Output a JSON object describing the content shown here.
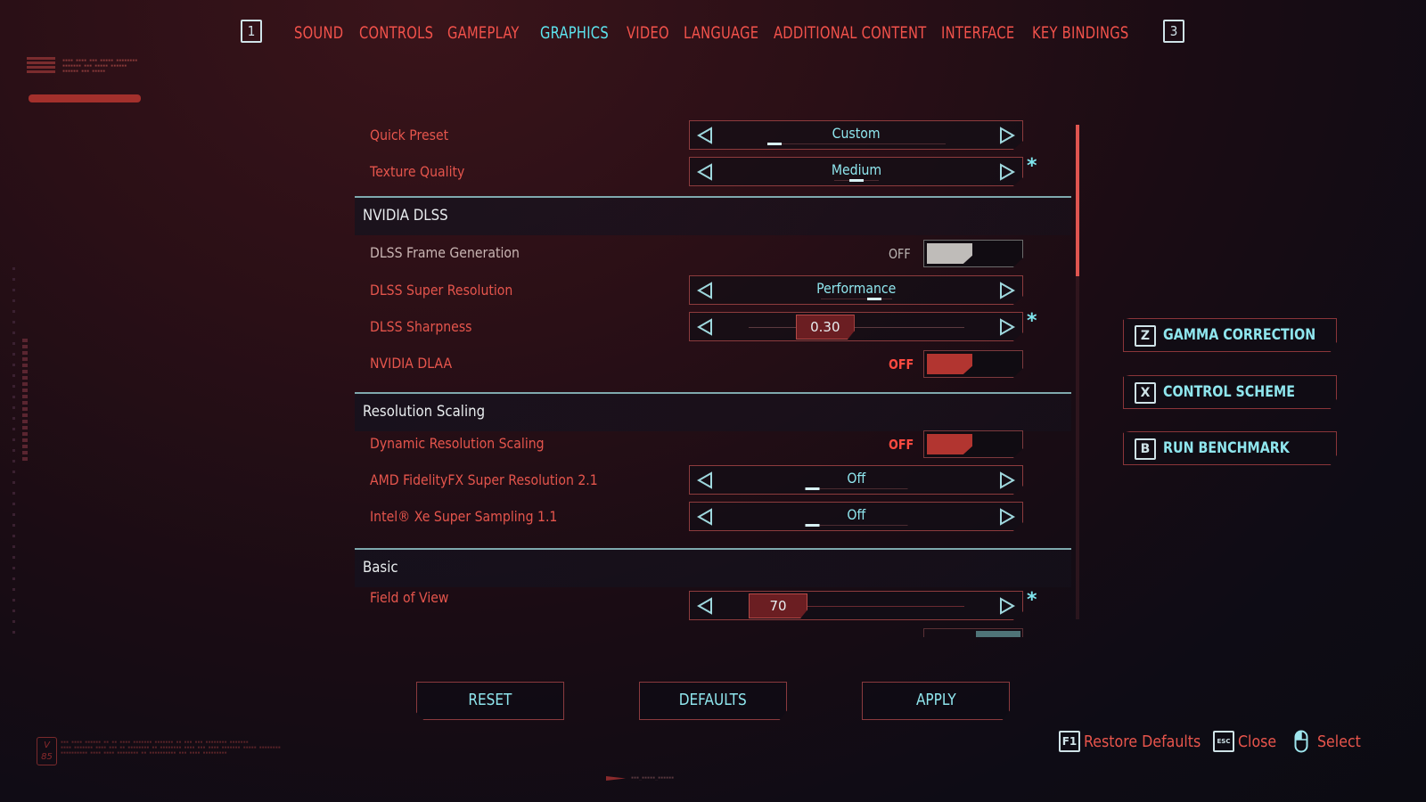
{
  "topnav": {
    "left_key": "1",
    "right_key": "3",
    "tabs": [
      {
        "label": "SOUND",
        "active": false
      },
      {
        "label": "CONTROLS",
        "active": false
      },
      {
        "label": "GAMEPLAY",
        "active": false
      },
      {
        "label": "GRAPHICS",
        "active": true
      },
      {
        "label": "VIDEO",
        "active": false
      },
      {
        "label": "LANGUAGE",
        "active": false
      },
      {
        "label": "ADDITIONAL CONTENT",
        "active": false
      },
      {
        "label": "INTERFACE",
        "active": false
      },
      {
        "label": "KEY BINDINGS",
        "active": false
      }
    ]
  },
  "settings": {
    "quick_preset": {
      "label": "Quick Preset",
      "value": "Custom"
    },
    "texture_quality": {
      "label": "Texture Quality",
      "value": "Medium",
      "requires_restart": "*"
    },
    "sections": {
      "dlss": "NVIDIA DLSS",
      "resolution_scaling": "Resolution Scaling",
      "basic": "Basic"
    },
    "dlss_frame_generation": {
      "label": "DLSS Frame Generation",
      "state": "OFF"
    },
    "dlss_super_resolution": {
      "label": "DLSS Super Resolution",
      "value": "Performance"
    },
    "dlss_sharpness": {
      "label": "DLSS Sharpness",
      "value": "0.30",
      "fraction": 0.3,
      "requires_restart": "*"
    },
    "nvidia_dlaa": {
      "label": "NVIDIA DLAA",
      "state": "OFF"
    },
    "dynamic_resolution_scaling": {
      "label": "Dynamic Resolution Scaling",
      "state": "OFF"
    },
    "amd_fsr": {
      "label": "AMD FidelityFX Super Resolution 2.1",
      "value": "Off"
    },
    "intel_xess": {
      "label": "Intel® Xe Super Sampling 1.1",
      "value": "Off"
    },
    "field_of_view": {
      "label": "Field of View",
      "value": "70",
      "min": 50,
      "max": 100,
      "requires_restart": "*"
    }
  },
  "side_buttons": [
    {
      "key": "Z",
      "label": "GAMMA CORRECTION"
    },
    {
      "key": "X",
      "label": "CONTROL SCHEME"
    },
    {
      "key": "B",
      "label": "RUN BENCHMARK"
    }
  ],
  "bottom_buttons": {
    "reset": "RESET",
    "defaults": "DEFAULTS",
    "apply": "APPLY"
  },
  "hints": [
    {
      "key": "F1",
      "label": "Restore Defaults"
    },
    {
      "key": "ESC",
      "label": "Close"
    },
    {
      "key": "mouse-icon",
      "label": "Select"
    }
  ],
  "decor": {
    "logo": "V 85"
  },
  "colors": {
    "accent_cyan": "#5ce3ee",
    "accent_red": "#f2524b",
    "toggle_on_red": "#b23530"
  }
}
